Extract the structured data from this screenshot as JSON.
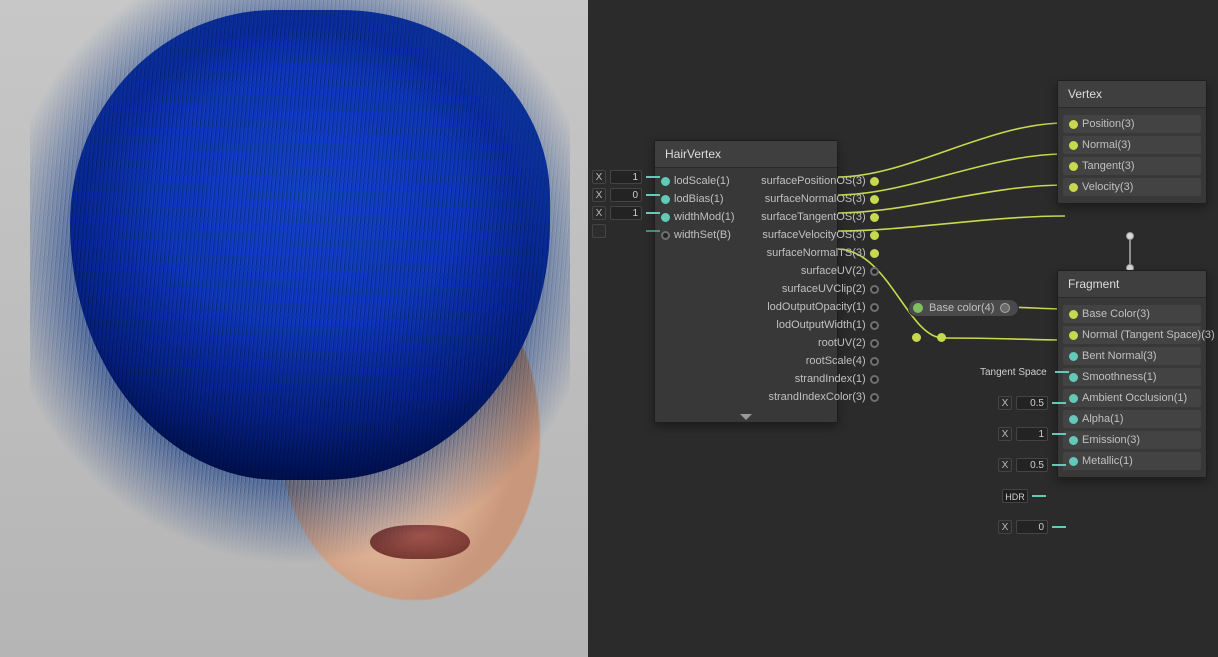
{
  "viewport_alt": "3D preview: character head with short blue hair, light grey background",
  "hairvertex": {
    "title": "HairVertex",
    "inputs": [
      {
        "label": "lodScale(1)",
        "field_kind": "num",
        "field_value": "1"
      },
      {
        "label": "lodBias(1)",
        "field_kind": "num",
        "field_value": "0"
      },
      {
        "label": "widthMod(1)",
        "field_kind": "num",
        "field_value": "1"
      },
      {
        "label": "widthSet(B)",
        "field_kind": "slot",
        "field_value": ""
      }
    ],
    "outputs": [
      {
        "label": "surfacePositionOS(3)"
      },
      {
        "label": "surfaceNormalOS(3)"
      },
      {
        "label": "surfaceTangentOS(3)"
      },
      {
        "label": "surfaceVelocityOS(3)"
      },
      {
        "label": "surfaceNormalTS(3)"
      },
      {
        "label": "surfaceUV(2)"
      },
      {
        "label": "surfaceUVClip(2)"
      },
      {
        "label": "lodOutputOpacity(1)"
      },
      {
        "label": "lodOutputWidth(1)"
      },
      {
        "label": "rootUV(2)"
      },
      {
        "label": "rootScale(4)"
      },
      {
        "label": "strandIndex(1)"
      },
      {
        "label": "strandIndexColor(3)"
      }
    ]
  },
  "vertex": {
    "title": "Vertex",
    "inputs": [
      {
        "label": "Position(3)"
      },
      {
        "label": "Normal(3)"
      },
      {
        "label": "Tangent(3)"
      },
      {
        "label": "Velocity(3)"
      }
    ]
  },
  "fragment": {
    "title": "Fragment",
    "inputs": [
      {
        "label": "Base Color(3)"
      },
      {
        "label": "Normal (Tangent Space)(3)"
      },
      {
        "label": "Bent Normal(3)",
        "inline_kind": "tangent_space",
        "inline_value": "Tangent Space"
      },
      {
        "label": "Smoothness(1)",
        "inline_kind": "num",
        "inline_value": "0.5"
      },
      {
        "label": "Ambient Occlusion(1)",
        "inline_kind": "num",
        "inline_value": "1"
      },
      {
        "label": "Alpha(1)",
        "inline_kind": "num",
        "inline_value": "0.5"
      },
      {
        "label": "Emission(3)",
        "inline_kind": "hdr",
        "inline_value": "HDR"
      },
      {
        "label": "Metallic(1)",
        "inline_kind": "num",
        "inline_value": "0"
      }
    ]
  },
  "basecolor_chip": {
    "label": "Base color(4)"
  },
  "connections": [
    {
      "from": "hairvertex.outputs.0",
      "to": "vertex.inputs.0"
    },
    {
      "from": "hairvertex.outputs.1",
      "to": "vertex.inputs.1"
    },
    {
      "from": "hairvertex.outputs.2",
      "to": "vertex.inputs.2"
    },
    {
      "from": "hairvertex.outputs.3",
      "to": "vertex.inputs.3"
    },
    {
      "from": "hairvertex.outputs.4",
      "to": "relay.right"
    },
    {
      "from": "relay.right",
      "to": "fragment.inputs.1"
    },
    {
      "from": "basecolor.out",
      "to": "fragment.inputs.0"
    }
  ]
}
